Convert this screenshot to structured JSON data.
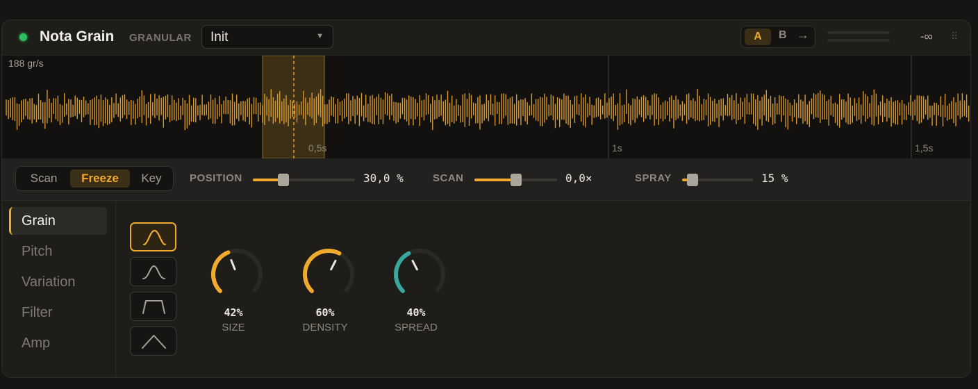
{
  "header": {
    "title": "Nota Grain",
    "engine": "GRANULAR",
    "preset": "Init",
    "ab": {
      "a": "A",
      "b": "B",
      "copy_icon": "arrow-right-icon"
    },
    "level_db": "-∞",
    "status_color": "#2fbf63"
  },
  "waveform": {
    "rate": "188 gr/s",
    "ticks": [
      "0,5s",
      "1s",
      "1,5s"
    ],
    "accent": "#f0aa2e",
    "selection_color": "#4a3a18"
  },
  "controls": {
    "modes": [
      "Scan",
      "Freeze",
      "Key"
    ],
    "active_mode": "Freeze",
    "position": {
      "label": "POSITION",
      "value": "30,0 %",
      "level": 0.3
    },
    "scan": {
      "label": "SCAN",
      "value": "0,0×",
      "level": 0.5
    },
    "spray": {
      "label": "SPRAY",
      "value": "15 %",
      "level": 0.15
    }
  },
  "sidebar": {
    "items": [
      "Grain",
      "Pitch",
      "Variation",
      "Filter",
      "Amp"
    ],
    "active": "Grain"
  },
  "grain": {
    "shapes": [
      "gaussian-envelope-icon",
      "hann-envelope-icon",
      "trapezoid-envelope-icon",
      "triangle-envelope-icon"
    ],
    "active_shape": 0,
    "knobs": [
      {
        "name": "size",
        "value": "42%",
        "label": "SIZE",
        "level": 0.42,
        "color": "#f0aa2e"
      },
      {
        "name": "density",
        "value": "60%",
        "label": "DENSITY",
        "level": 0.6,
        "color": "#f0aa2e"
      },
      {
        "name": "spread",
        "value": "40%",
        "label": "SPREAD",
        "level": 0.4,
        "color": "#3aa6a0"
      }
    ]
  }
}
